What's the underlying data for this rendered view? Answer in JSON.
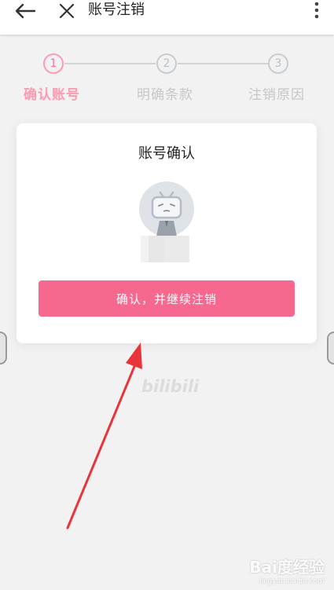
{
  "header": {
    "title": "账号注销",
    "back_icon": "arrow-left-icon",
    "close_icon": "close-icon",
    "more_icon": "more-vertical-icon"
  },
  "stepper": {
    "steps": [
      {
        "number": "1",
        "label": "确认账号",
        "active": true
      },
      {
        "number": "2",
        "label": "明确条款",
        "active": false
      },
      {
        "number": "3",
        "label": "注销原因",
        "active": false
      }
    ],
    "active_color": "#fb7299",
    "inactive_color": "#c8cdd2"
  },
  "card": {
    "title": "账号确认",
    "avatar_icon": "bilibili-tv-avatar-icon",
    "confirm_button_label": "确认，并继续注销",
    "button_color": "#f7688f"
  },
  "logo": {
    "text": "bilibili"
  },
  "watermark": {
    "brand": "Bai度经验",
    "url": "jingyan.baidu.com"
  },
  "annotation": {
    "arrow_color": "#e8343a"
  }
}
